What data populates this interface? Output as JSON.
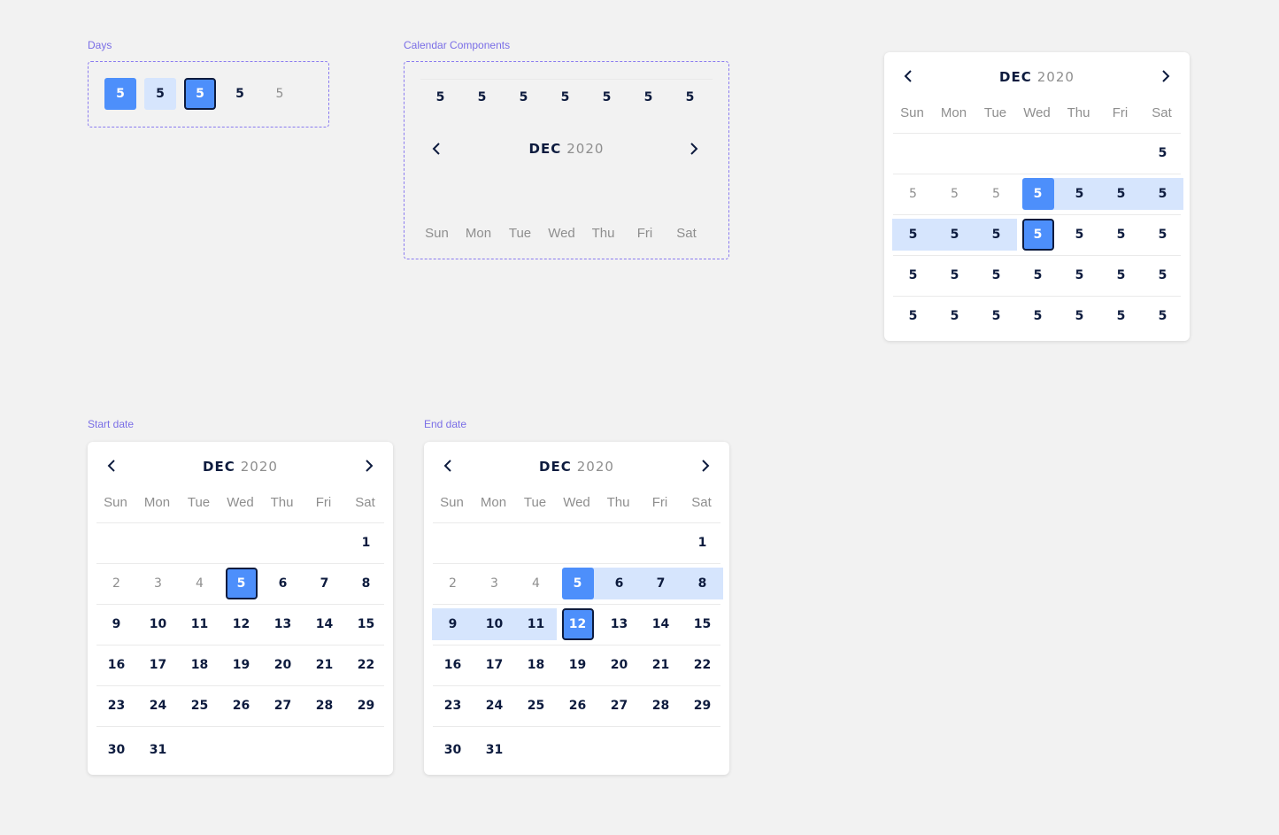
{
  "labels": {
    "days": "Days",
    "components": "Calendar Components",
    "start": "Start date",
    "end": "End date"
  },
  "days_variants": [
    "5",
    "5",
    "5",
    "5",
    "5"
  ],
  "month": "DEC",
  "year": "2020",
  "weekdays": [
    "Sun",
    "Mon",
    "Tue",
    "Wed",
    "Thu",
    "Fri",
    "Sat"
  ],
  "component_days": [
    "5",
    "5",
    "5",
    "5",
    "5",
    "5",
    "5"
  ],
  "template_calendar": {
    "rows": [
      [
        {
          "t": "",
          "s": "n"
        },
        {
          "t": "",
          "s": "n"
        },
        {
          "t": "",
          "s": "n"
        },
        {
          "t": "",
          "s": "n"
        },
        {
          "t": "",
          "s": "n"
        },
        {
          "t": "",
          "s": "n"
        },
        {
          "t": "5",
          "s": "n"
        }
      ],
      [
        {
          "t": "5",
          "s": "m"
        },
        {
          "t": "5",
          "s": "m"
        },
        {
          "t": "5",
          "s": "m"
        },
        {
          "t": "5",
          "s": "sel-start"
        },
        {
          "t": "5",
          "s": "r"
        },
        {
          "t": "5",
          "s": "r"
        },
        {
          "t": "5",
          "s": "r"
        }
      ],
      [
        {
          "t": "5",
          "s": "r"
        },
        {
          "t": "5",
          "s": "r"
        },
        {
          "t": "5",
          "s": "r"
        },
        {
          "t": "5",
          "s": "cur"
        },
        {
          "t": "5",
          "s": "n"
        },
        {
          "t": "5",
          "s": "n"
        },
        {
          "t": "5",
          "s": "n"
        }
      ],
      [
        {
          "t": "5",
          "s": "n"
        },
        {
          "t": "5",
          "s": "n"
        },
        {
          "t": "5",
          "s": "n"
        },
        {
          "t": "5",
          "s": "n"
        },
        {
          "t": "5",
          "s": "n"
        },
        {
          "t": "5",
          "s": "n"
        },
        {
          "t": "5",
          "s": "n"
        }
      ],
      [
        {
          "t": "5",
          "s": "n"
        },
        {
          "t": "5",
          "s": "n"
        },
        {
          "t": "5",
          "s": "n"
        },
        {
          "t": "5",
          "s": "n"
        },
        {
          "t": "5",
          "s": "n"
        },
        {
          "t": "5",
          "s": "n"
        },
        {
          "t": "5",
          "s": "n"
        }
      ]
    ]
  },
  "start_calendar": {
    "rows": [
      [
        {
          "t": "",
          "s": "n"
        },
        {
          "t": "",
          "s": "n"
        },
        {
          "t": "",
          "s": "n"
        },
        {
          "t": "",
          "s": "n"
        },
        {
          "t": "",
          "s": "n"
        },
        {
          "t": "",
          "s": "n"
        },
        {
          "t": "1",
          "s": "n"
        }
      ],
      [
        {
          "t": "2",
          "s": "m"
        },
        {
          "t": "3",
          "s": "m"
        },
        {
          "t": "4",
          "s": "m"
        },
        {
          "t": "5",
          "s": "cur"
        },
        {
          "t": "6",
          "s": "n"
        },
        {
          "t": "7",
          "s": "n"
        },
        {
          "t": "8",
          "s": "n"
        }
      ],
      [
        {
          "t": "9",
          "s": "n"
        },
        {
          "t": "10",
          "s": "n"
        },
        {
          "t": "11",
          "s": "n"
        },
        {
          "t": "12",
          "s": "n"
        },
        {
          "t": "13",
          "s": "n"
        },
        {
          "t": "14",
          "s": "n"
        },
        {
          "t": "15",
          "s": "n"
        }
      ],
      [
        {
          "t": "16",
          "s": "n"
        },
        {
          "t": "17",
          "s": "n"
        },
        {
          "t": "18",
          "s": "n"
        },
        {
          "t": "19",
          "s": "n"
        },
        {
          "t": "20",
          "s": "n"
        },
        {
          "t": "21",
          "s": "n"
        },
        {
          "t": "22",
          "s": "n"
        }
      ],
      [
        {
          "t": "23",
          "s": "n"
        },
        {
          "t": "24",
          "s": "n"
        },
        {
          "t": "25",
          "s": "n"
        },
        {
          "t": "26",
          "s": "n"
        },
        {
          "t": "27",
          "s": "n"
        },
        {
          "t": "28",
          "s": "n"
        },
        {
          "t": "29",
          "s": "n"
        }
      ],
      [
        {
          "t": "30",
          "s": "n"
        },
        {
          "t": "31",
          "s": "n"
        }
      ]
    ]
  },
  "end_calendar": {
    "rows": [
      [
        {
          "t": "",
          "s": "n"
        },
        {
          "t": "",
          "s": "n"
        },
        {
          "t": "",
          "s": "n"
        },
        {
          "t": "",
          "s": "n"
        },
        {
          "t": "",
          "s": "n"
        },
        {
          "t": "",
          "s": "n"
        },
        {
          "t": "1",
          "s": "n"
        }
      ],
      [
        {
          "t": "2",
          "s": "m"
        },
        {
          "t": "3",
          "s": "m"
        },
        {
          "t": "4",
          "s": "m"
        },
        {
          "t": "5",
          "s": "sel-start"
        },
        {
          "t": "6",
          "s": "r"
        },
        {
          "t": "7",
          "s": "r"
        },
        {
          "t": "8",
          "s": "r"
        }
      ],
      [
        {
          "t": "9",
          "s": "r"
        },
        {
          "t": "10",
          "s": "r"
        },
        {
          "t": "11",
          "s": "r"
        },
        {
          "t": "12",
          "s": "cur"
        },
        {
          "t": "13",
          "s": "n"
        },
        {
          "t": "14",
          "s": "n"
        },
        {
          "t": "15",
          "s": "n"
        }
      ],
      [
        {
          "t": "16",
          "s": "n"
        },
        {
          "t": "17",
          "s": "n"
        },
        {
          "t": "18",
          "s": "n"
        },
        {
          "t": "19",
          "s": "n"
        },
        {
          "t": "20",
          "s": "n"
        },
        {
          "t": "21",
          "s": "n"
        },
        {
          "t": "22",
          "s": "n"
        }
      ],
      [
        {
          "t": "23",
          "s": "n"
        },
        {
          "t": "24",
          "s": "n"
        },
        {
          "t": "25",
          "s": "n"
        },
        {
          "t": "26",
          "s": "n"
        },
        {
          "t": "27",
          "s": "n"
        },
        {
          "t": "28",
          "s": "n"
        },
        {
          "t": "29",
          "s": "n"
        }
      ],
      [
        {
          "t": "30",
          "s": "n"
        },
        {
          "t": "31",
          "s": "n"
        }
      ]
    ]
  },
  "colors": {
    "accent": "#4d8ffb",
    "range": "#d6e5fd",
    "label": "#7a6ee6",
    "text": "#0d1b3e",
    "muted": "#8e8e8e"
  },
  "icons": {
    "prev": "chevron-left-icon",
    "next": "chevron-right-icon"
  }
}
